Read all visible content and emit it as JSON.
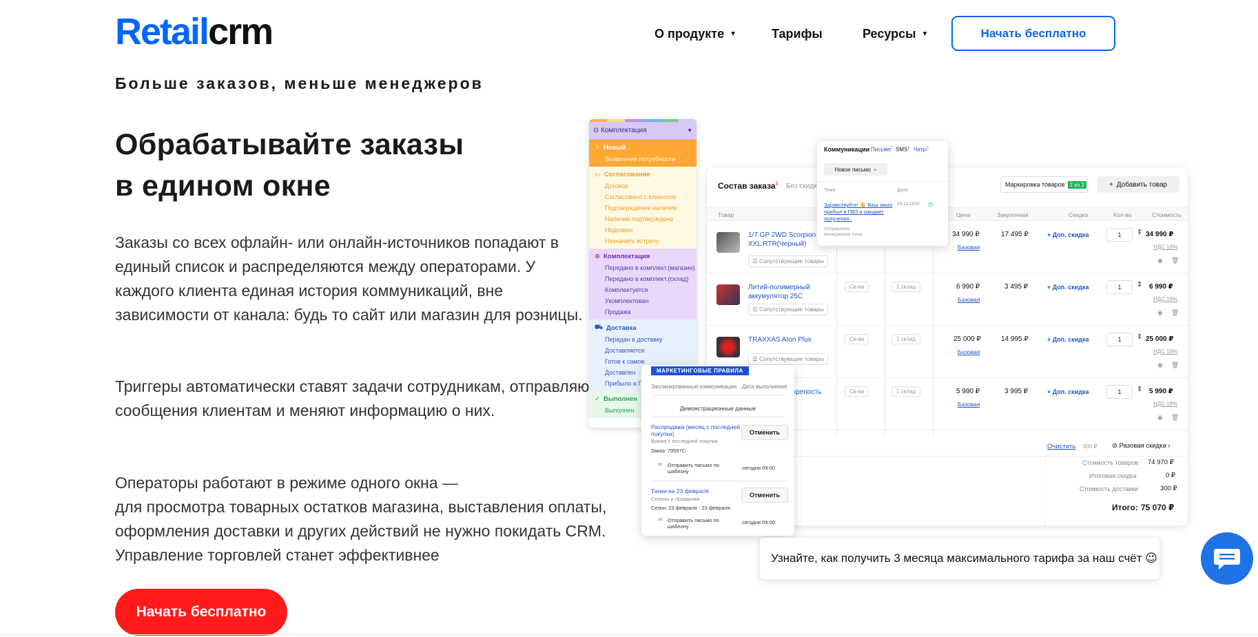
{
  "header": {
    "logo_part1": "Retail",
    "logo_part2": "crm",
    "nav": [
      {
        "label": "О продукте",
        "dropdown": true
      },
      {
        "label": "Тарифы",
        "dropdown": false
      },
      {
        "label": "Ресурсы",
        "dropdown": true
      }
    ],
    "cta": "Начать бесплатно"
  },
  "hero": {
    "tagline": "Больше заказов, меньше менеджеров",
    "title_line1": "Обрабатывайте заказы",
    "title_line2": "в едином окне",
    "para1": "Заказы со всех офлайн- или онлайн-источников попадают в единый список и распределяются между операторами. У каждого клиента единая история коммуникаций, вне зависимости от канала: будь то сайт или магазин для розницы.",
    "para2": "Триггеры автоматически ставят задачи сотрудникам, отправляют сообщения клиентам и меняют информацию о них.",
    "para3_line1": "Операторы работают в режиме одного окна —",
    "para3_rest": "для просмотра товарных остатков магазина, выставления оплаты, оформления доставки и других действий не нужно покидать CRM. Управление торговлей станет эффективнее",
    "cta": "Начать бесплатно"
  },
  "status_panel": {
    "header": "Комплектация",
    "groups": [
      {
        "title": "Новый",
        "items": [
          "Выявление потребности"
        ]
      },
      {
        "title": "Согласование",
        "items": [
          "Договор",
          "Согласовано с клиентом",
          "Подтверждение наличия",
          "Наличие подтверждено",
          "Недозвон",
          "Назначить встречу"
        ]
      },
      {
        "title": "Комплектация",
        "items": [
          "Передано в комплект.(магазин)",
          "Передано в комплект.(склад)",
          "Комплектуется",
          "Укомплектован",
          "Продажа"
        ]
      },
      {
        "title": "Доставка",
        "items": [
          "Передан в доставку",
          "Доставляется",
          "Готов к самов",
          "Доставлен",
          "Прибыло в ПВ"
        ]
      },
      {
        "title": "Выполнен",
        "items": [
          "Выполнен"
        ]
      }
    ]
  },
  "order": {
    "title": "Состав заказа",
    "title_count": "3",
    "subtitle": "Без скидк",
    "marking_label": "Маркировка товаров",
    "marking_badge": "2 из 2",
    "add_button": "Добавить товар",
    "columns": {
      "product": "Товар",
      "price": "Цена",
      "purchase": "Закупочная",
      "discount": "Скидка",
      "qty": "Кол-во",
      "cost": "Стоимость"
    },
    "related": "Сопутствующие товары",
    "props": "Св-ва",
    "base": "Базовая",
    "add_discount": "+ Доп. скидка",
    "nds": "НДС 18%",
    "rows": [
      {
        "name": "1/7 GP 2WD Scorpion B-XXL RTR(Черный)",
        "stock": "",
        "price": "34 990 ₽",
        "purchase": "17 495 ₽",
        "qty": "1",
        "total": "34 990 ₽"
      },
      {
        "name": "Литий-полимерный аккумулятор 25С",
        "stock": "1 склад",
        "price": "6 990 ₽",
        "purchase": "3 495 ₽",
        "qty": "1",
        "total": "6 990 ₽"
      },
      {
        "name": "TRAXXAS Aton Plus",
        "stock": "1 склад",
        "price": "25 000 ₽",
        "purchase": "14 995 ₽",
        "qty": "1",
        "total": "25 000 ₽"
      },
      {
        "name": "крепость",
        "stock": "1 склад",
        "price": "5 990 ₽",
        "purchase": "3 995 ₽",
        "qty": "1",
        "total": "5 990 ₽"
      }
    ],
    "clear": "Очистить",
    "clear_value": "300 ₽",
    "one_time_discount": "Разовая скидка",
    "summary": [
      {
        "label": "Стоимость товаров",
        "value": "74 970 ₽"
      },
      {
        "label": "Итоговая скидка",
        "value": "0 ₽"
      },
      {
        "label": "Стоимость доставки",
        "value": "300 ₽"
      }
    ],
    "total_label": "Итого:",
    "total_value": "75 070 ₽"
  },
  "communications": {
    "title": "Коммуникации",
    "tabs": [
      "Письма",
      "SMS",
      "Чаты"
    ],
    "tab_counts": [
      "2",
      "1",
      "3"
    ],
    "new_letter": "Новое письмо",
    "col_topic": "Тема",
    "col_date": "Дата",
    "msg": "Здравствуйте! 👋 Ваш заказ прибыл в ПВЗ и ожидает получения..",
    "msg_date": "23.12.2020",
    "sent_by": "Отправлено менеджером Анна"
  },
  "marketing": {
    "badge": "МАРКЕТИНГОВЫЕ ПРАВИЛА",
    "tab1": "Запланированные коммуникации",
    "tab2": "Дата выполнения",
    "demo": "Демонстрационные данные",
    "rules": [
      {
        "title": "Распродажа (месяц с последней покупки)",
        "sub": "Время с последней покупки",
        "order": "Заказ: 70597С",
        "action": "Отправить письмо по шаблону",
        "time": "сегодня 09:00",
        "button": "Отменить"
      },
      {
        "title": "Танки на 23 февраля",
        "sub": "Сезоны и праздники",
        "order": "Сезон: 23 февраля - 23 февраля",
        "action": "Отправить письмо по шаблону",
        "time": "сегодня 09:00",
        "button": "Отменить"
      }
    ]
  },
  "promo": {
    "text": "Узнайте, как получить 3 месяца максимального тарифа за наш счёт",
    "emoji": "😉"
  },
  "colors": {
    "brand_blue": "#0066ff",
    "cta_red": "#ff1b1b",
    "outline_blue": "#0a66e4"
  }
}
